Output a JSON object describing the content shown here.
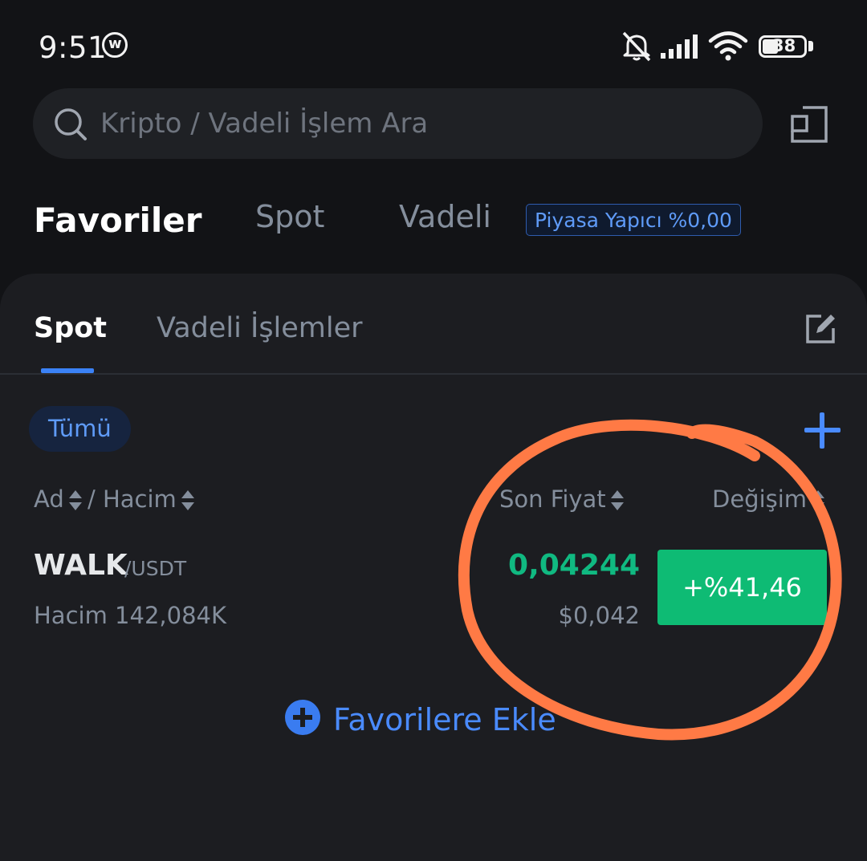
{
  "status_bar": {
    "time": "9:51",
    "battery": "38"
  },
  "search": {
    "placeholder": "Kripto / Vadeli İşlem Ara"
  },
  "top_tabs": [
    {
      "label": "Favoriler",
      "active": true
    },
    {
      "label": "Spot",
      "active": false
    },
    {
      "label": "Vadeli",
      "active": false
    }
  ],
  "market_maker_badge": "Piyasa Yapıcı %0,00",
  "sub_tabs": [
    {
      "label": "Spot",
      "active": true
    },
    {
      "label": "Vadeli İşlemler",
      "active": false
    }
  ],
  "filter_chip": "Tümü",
  "columns": {
    "name": "Ad",
    "separator": "/",
    "volume": "Hacim",
    "last_price": "Son Fiyat",
    "change": "Değişim"
  },
  "rows": [
    {
      "base": "WALK",
      "quote": "/USDT",
      "volume": "Hacim 142,084K",
      "price": "0,04244",
      "price_usd": "$0,042",
      "change": "+%41,46"
    }
  ],
  "add_favorites_label": "Favorilere Ekle",
  "colors": {
    "background": "#121316",
    "panel": "#1c1d21",
    "accent_blue": "#4a8bff",
    "positive_green": "#0ebb74",
    "annotation_orange": "#ff7a45"
  },
  "annotation": {
    "type": "hand-drawn-circle",
    "color": "#ff7a45"
  }
}
